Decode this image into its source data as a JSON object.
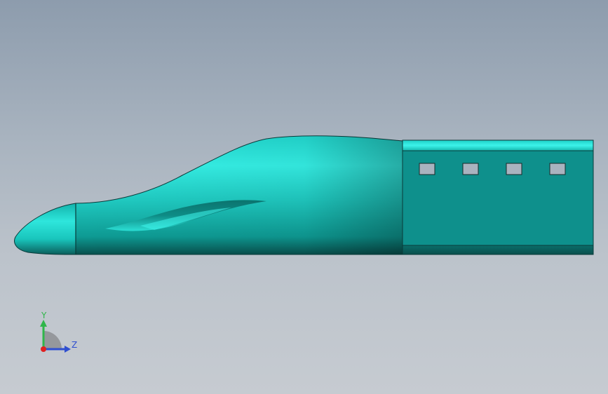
{
  "viewport": {
    "background_top": "#8d9cad",
    "background_bottom": "#c6cbd1"
  },
  "model": {
    "color_body": "#10a8a0",
    "color_highlight": "#2ee6dc",
    "color_side_panel": "#0e908c",
    "color_window": "#a9b3bf",
    "edge_color": "#0a3b3a",
    "window_count": 4
  },
  "triad": {
    "y_label": "Y",
    "z_label": "Z",
    "y_color": "#2fb64a",
    "z_color": "#2f4fd0",
    "x_color": "#e02020"
  }
}
